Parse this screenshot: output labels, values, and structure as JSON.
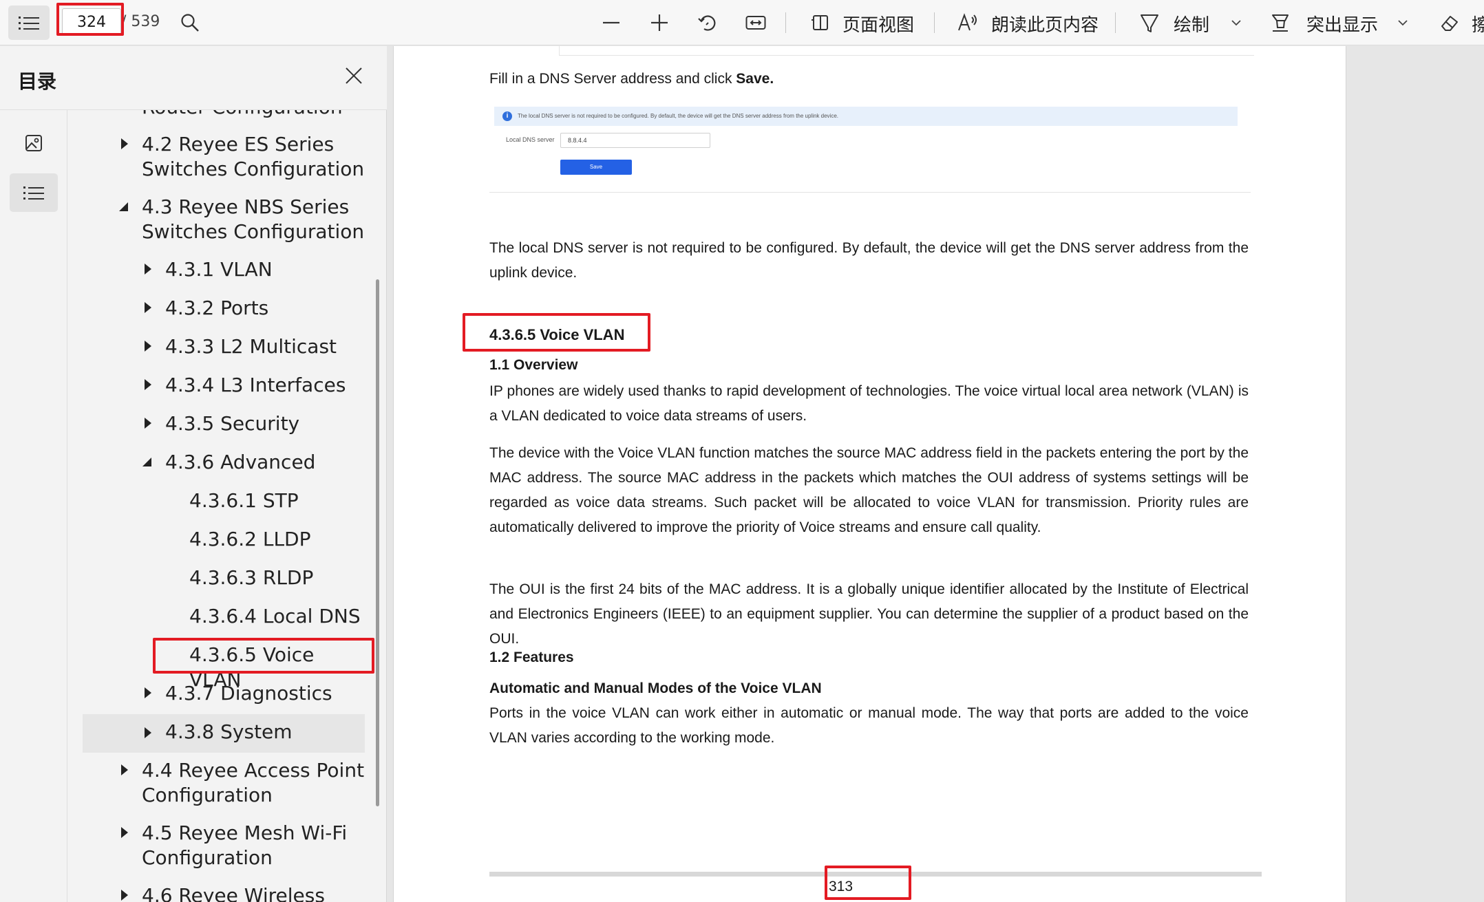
{
  "toolbar": {
    "current_page": "324",
    "total_pages": "/ 539",
    "page_view_label": "页面视图",
    "read_aloud_label": "朗读此页内容",
    "draw_label": "绘制",
    "highlight_label": "突出显示",
    "overflow_label": "擦"
  },
  "toc": {
    "title": "目录",
    "items": [
      {
        "label": "Router Configuration"
      },
      {
        "label": "4.2 Reyee ES Series"
      },
      {
        "label": "Switches Configuration"
      },
      {
        "label": "4.3 Reyee NBS Series"
      },
      {
        "label": "Switches Configuration"
      },
      {
        "label": "4.3.1 VLAN"
      },
      {
        "label": "4.3.2 Ports"
      },
      {
        "label": "4.3.3 L2 Multicast"
      },
      {
        "label": "4.3.4 L3 Interfaces"
      },
      {
        "label": "4.3.5 Security"
      },
      {
        "label": "4.3.6 Advanced"
      },
      {
        "label": "4.3.6.1 STP"
      },
      {
        "label": "4.3.6.2 LLDP"
      },
      {
        "label": "4.3.6.3 RLDP"
      },
      {
        "label": "4.3.6.4 Local DNS"
      },
      {
        "label": "4.3.6.5 Voice VLAN"
      },
      {
        "label": "4.3.7 Diagnostics"
      },
      {
        "label": "4.3.8 System"
      },
      {
        "label": "4.4 Reyee Access Point"
      },
      {
        "label": "Configuration"
      },
      {
        "label": "4.5 Reyee Mesh Wi-Fi"
      },
      {
        "label": "Configuration"
      },
      {
        "label": "4.6 Reyee Wireless"
      }
    ]
  },
  "document": {
    "intro_prefix": "Fill in a DNS Server address and click ",
    "intro_bold": "Save.",
    "embedded": {
      "note": "The local DNS server is not required to be configured. By default, the device will get the DNS server address from the uplink device.",
      "field_label": "Local DNS server",
      "field_value": "8.8.4.4",
      "button": "Save"
    },
    "para_dns": "The local DNS server is not required to be configured. By default, the device will get the DNS server address from the uplink device.",
    "section_heading": "4.3.6.5 Voice VLAN",
    "overview_heading": "1.1 Overview",
    "para_overview": "IP phones are widely used thanks to rapid development of technologies. The voice virtual local area network (VLAN) is a VLAN dedicated to voice data streams of users.",
    "para_match": "The device with the Voice VLAN function matches the source MAC address field in the packets entering the port by the MAC address. The source MAC address in the packets which matches the OUI address of systems settings will be regarded as voice data streams. Such packet will be allocated to voice VLAN for transmission. Priority rules are automatically delivered to improve the priority of Voice streams and ensure call quality.",
    "para_oui": "The OUI is the first 24 bits of the MAC address. It is a globally unique identifier allocated by the Institute of Electrical and Electronics Engineers (IEEE) to an equipment supplier. You can determine the supplier of a product based on the OUI.",
    "features_heading": "1.2 Features",
    "modes_heading": "Automatic and Manual Modes of the Voice VLAN",
    "para_modes": "Ports in the voice VLAN can work either in automatic or manual mode. The way that ports are added to the voice VLAN varies according to the working mode.",
    "page_number": "313"
  },
  "colors": {
    "highlight_box": "#e31b23",
    "save_button": "#2461e5",
    "note_bg": "#e7f0fb"
  }
}
